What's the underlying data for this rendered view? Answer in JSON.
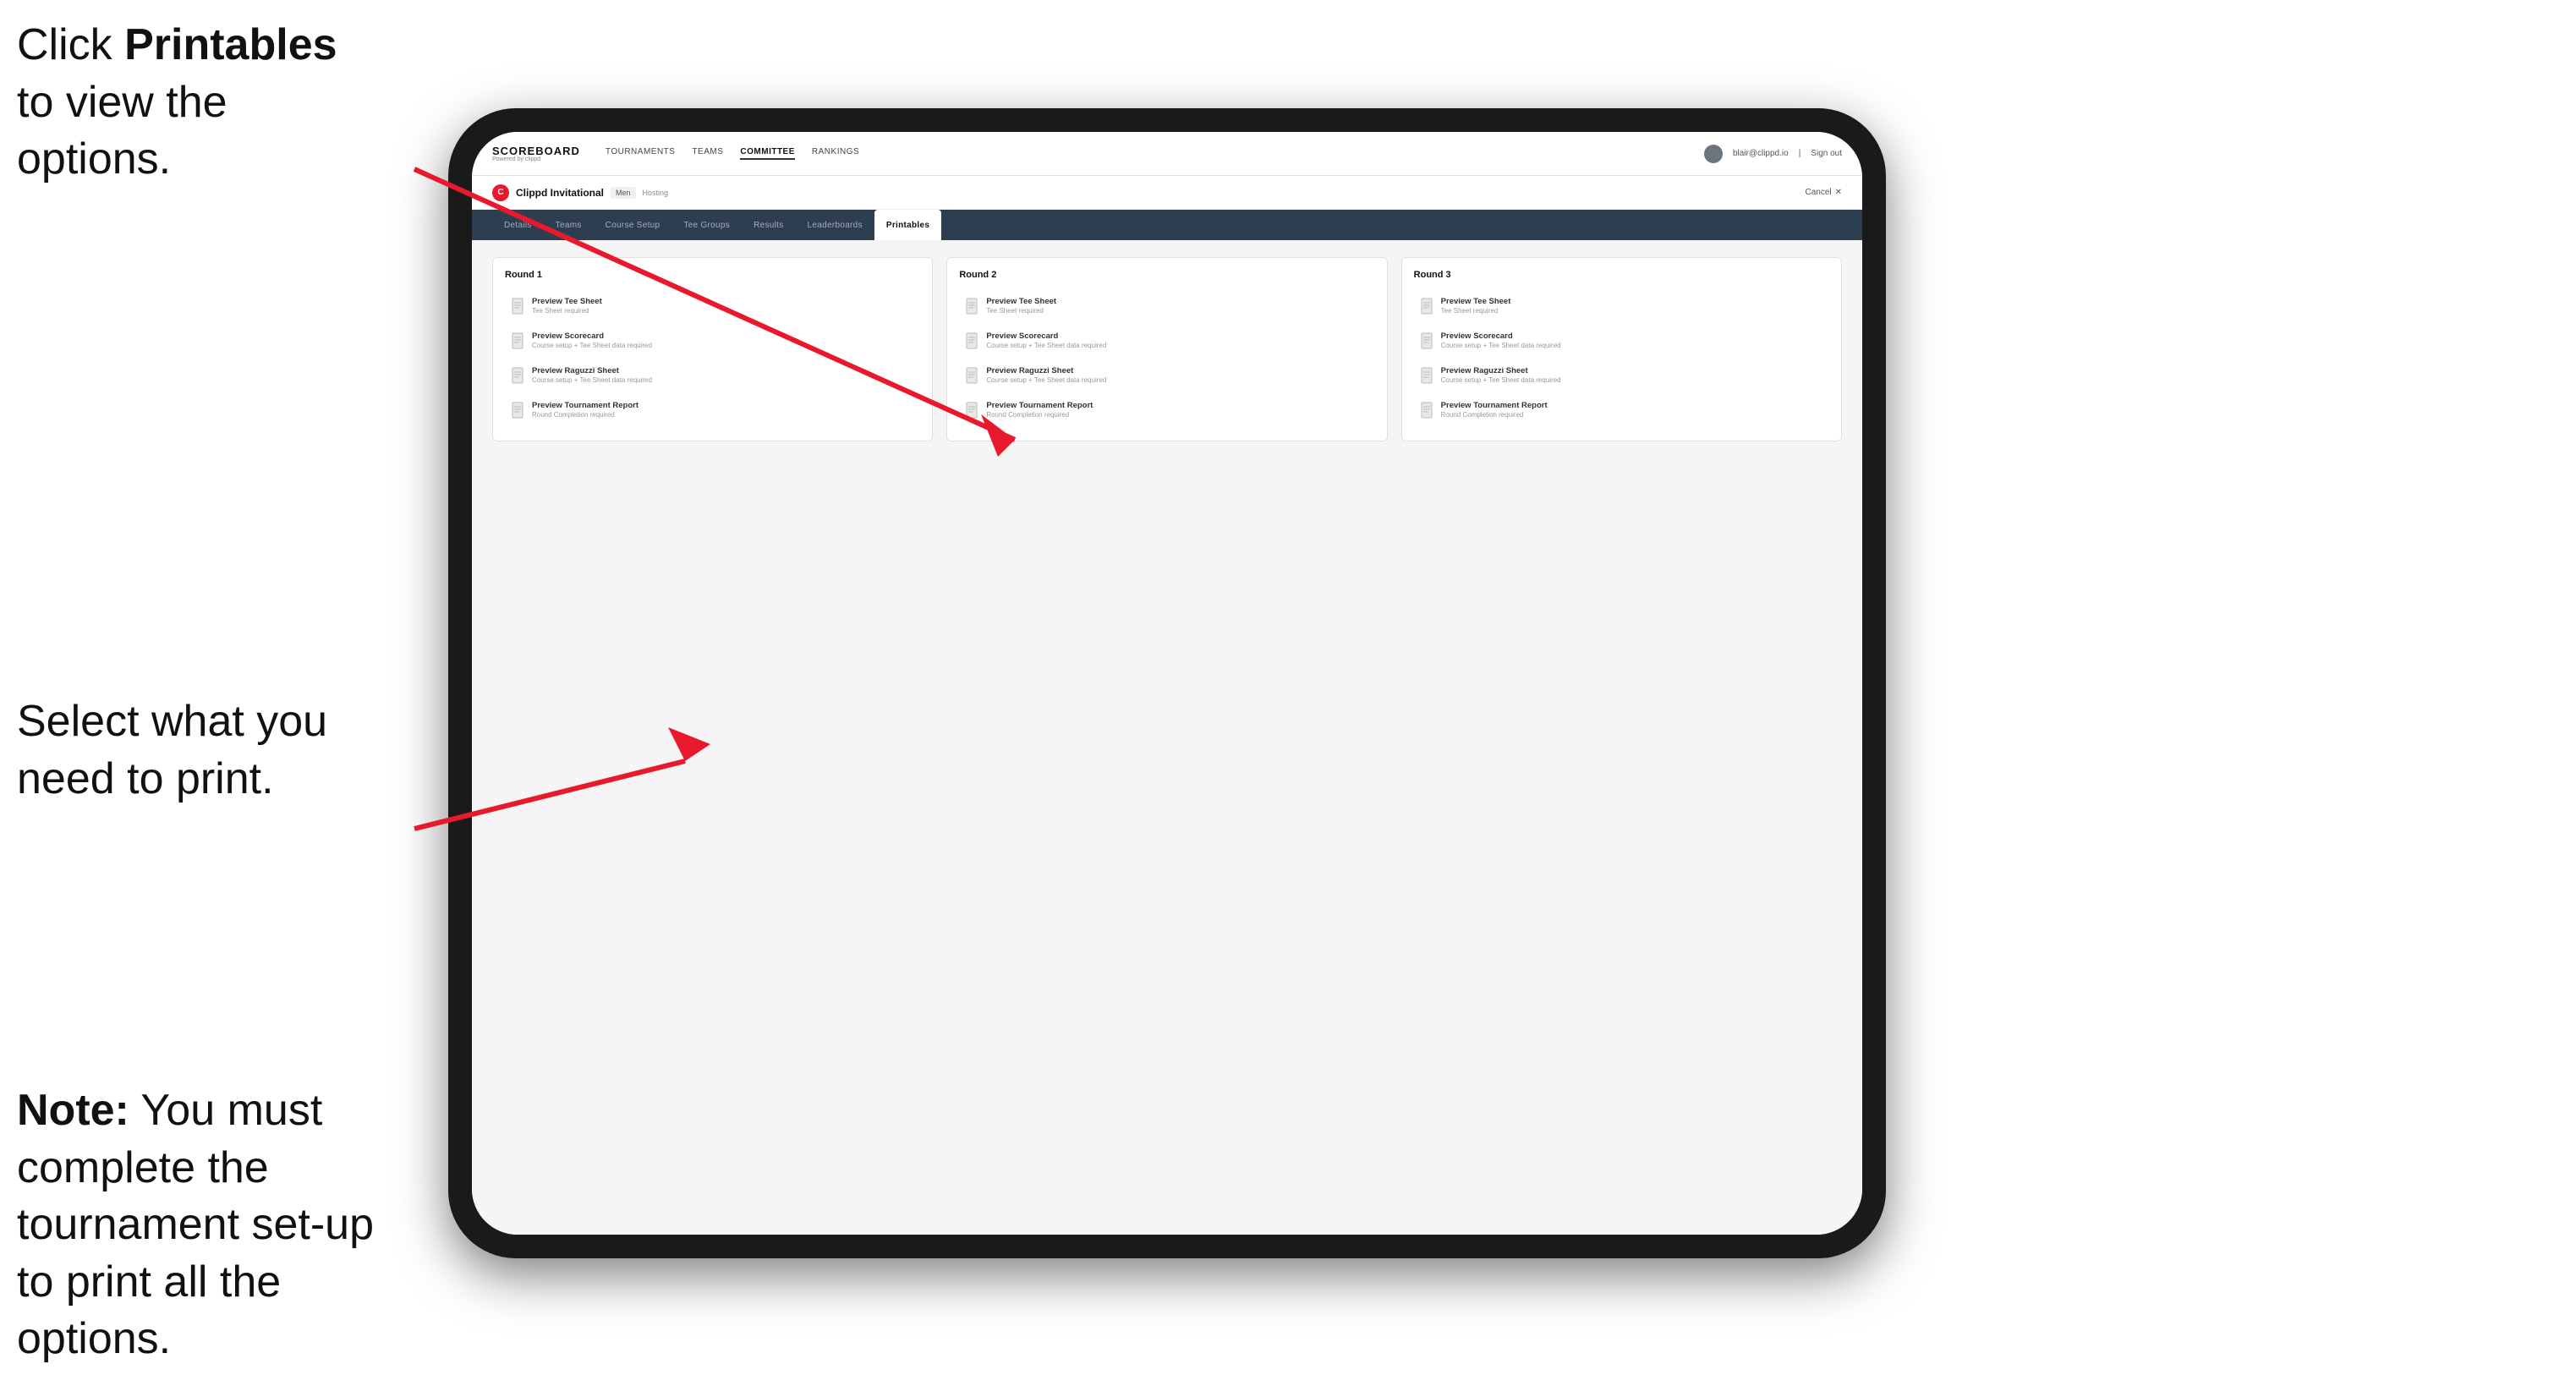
{
  "annotations": {
    "top": {
      "prefix": "Click ",
      "bold": "Printables",
      "suffix": " to\nview the options."
    },
    "middle": {
      "text": "Select what you\nneed to print."
    },
    "bottom": {
      "bold": "Note:",
      "suffix": " You must\ncomplete the\ntournament set-up\nto print all the options."
    }
  },
  "topNav": {
    "logo": "SCOREBOARD",
    "logosub": "Powered by clippd",
    "links": [
      {
        "label": "TOURNAMENTS",
        "active": false
      },
      {
        "label": "TEAMS",
        "active": false
      },
      {
        "label": "COMMITTEE",
        "active": false
      },
      {
        "label": "RANKINGS",
        "active": false
      }
    ],
    "user": "blair@clippd.io",
    "signout": "Sign out"
  },
  "tournamentHeader": {
    "logo": "C",
    "name": "Clippd Invitational",
    "badge": "Men",
    "status": "Hosting",
    "cancel": "Cancel"
  },
  "subNav": {
    "tabs": [
      {
        "label": "Details",
        "active": false
      },
      {
        "label": "Teams",
        "active": false
      },
      {
        "label": "Course Setup",
        "active": false
      },
      {
        "label": "Tee Groups",
        "active": false
      },
      {
        "label": "Results",
        "active": false
      },
      {
        "label": "Leaderboards",
        "active": false
      },
      {
        "label": "Printables",
        "active": true
      }
    ]
  },
  "rounds": [
    {
      "title": "Round 1",
      "items": [
        {
          "label": "Preview Tee Sheet",
          "sub": "Tee Sheet required"
        },
        {
          "label": "Preview Scorecard",
          "sub": "Course setup + Tee Sheet data required"
        },
        {
          "label": "Preview Raguzzi Sheet",
          "sub": "Course setup + Tee Sheet data required"
        },
        {
          "label": "Preview Tournament Report",
          "sub": "Round Completion required"
        }
      ]
    },
    {
      "title": "Round 2",
      "items": [
        {
          "label": "Preview Tee Sheet",
          "sub": "Tee Sheet required"
        },
        {
          "label": "Preview Scorecard",
          "sub": "Course setup + Tee Sheet data required"
        },
        {
          "label": "Preview Raguzzi Sheet",
          "sub": "Course setup + Tee Sheet data required"
        },
        {
          "label": "Preview Tournament Report",
          "sub": "Round Completion required"
        }
      ]
    },
    {
      "title": "Round 3",
      "items": [
        {
          "label": "Preview Tee Sheet",
          "sub": "Tee Sheet required"
        },
        {
          "label": "Preview Scorecard",
          "sub": "Course setup + Tee Sheet data required"
        },
        {
          "label": "Preview Raguzzi Sheet",
          "sub": "Course setup + Tee Sheet data required"
        },
        {
          "label": "Preview Tournament Report",
          "sub": "Round Completion required"
        }
      ]
    }
  ]
}
